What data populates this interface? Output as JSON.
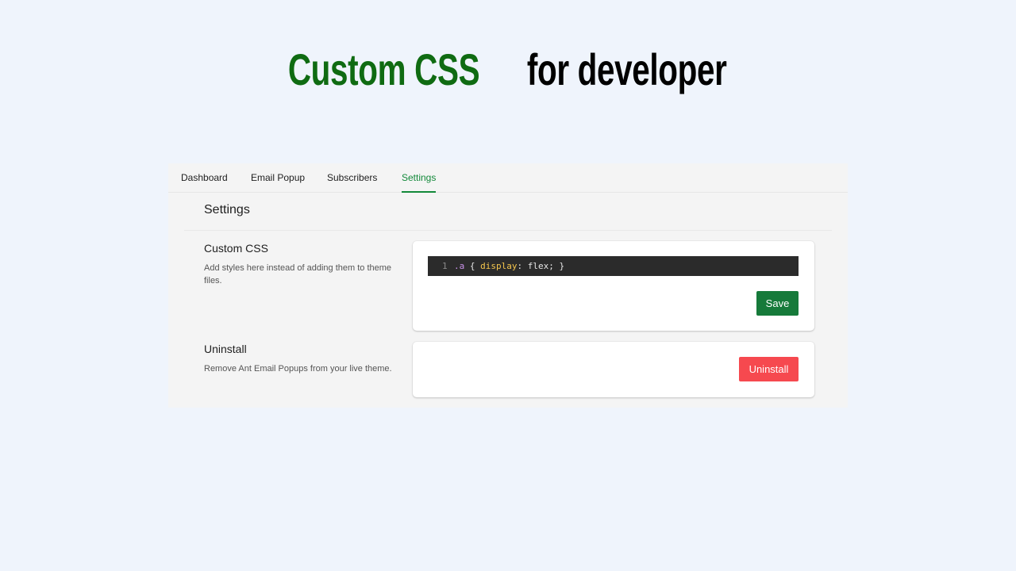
{
  "hero": {
    "highlight": "Custom CSS",
    "rest": "for developer"
  },
  "tabs": [
    {
      "label": "Dashboard"
    },
    {
      "label": "Email Popup"
    },
    {
      "label": "Subscribers"
    },
    {
      "label": "Settings"
    }
  ],
  "active_tab": "Settings",
  "page": {
    "title": "Settings"
  },
  "custom_css": {
    "title": "Custom CSS",
    "description": "Add styles here instead of adding them to theme files.",
    "editor": {
      "line_number": "1",
      "selector": ".a",
      "open": "{",
      "property": "display",
      "colon": ":",
      "value": "flex;",
      "close": "}"
    },
    "save_label": "Save"
  },
  "uninstall": {
    "title": "Uninstall",
    "description": "Remove Ant Email Popups from your live theme.",
    "button_label": "Uninstall"
  },
  "colors": {
    "background": "#eff4fc",
    "accent_green": "#13893a",
    "save_button": "#167a3a",
    "uninstall_button": "#f6494f",
    "hero_green": "#0f6b12"
  }
}
